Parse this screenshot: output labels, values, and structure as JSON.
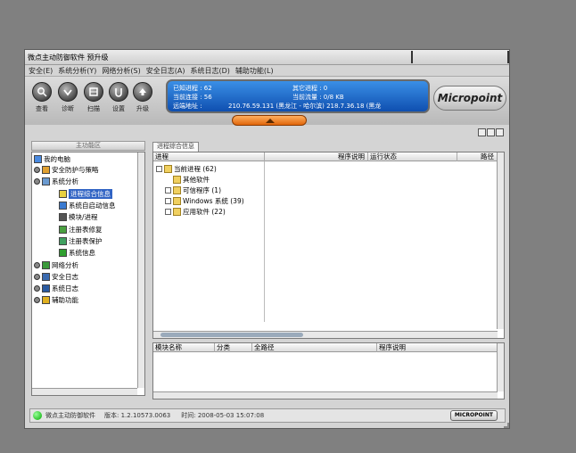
{
  "window": {
    "title": "微点主动防御软件  预升级"
  },
  "menu": [
    "安全(E)",
    "系统分析(Y)",
    "网络分析(S)",
    "安全日志(A)",
    "系统日志(D)",
    "辅助功能(L)"
  ],
  "toolbar": [
    {
      "label": "查看",
      "icon": "view-icon"
    },
    {
      "label": "诊断",
      "icon": "diagnose-icon"
    },
    {
      "label": "扫描",
      "icon": "scan-icon"
    },
    {
      "label": "设置",
      "icon": "settings-icon"
    },
    {
      "label": "升级",
      "icon": "upgrade-icon"
    }
  ],
  "info": {
    "known_label": "已知进程 : 62",
    "other_label": "其它进程 : 0",
    "conn_label": "当前连接 : 56",
    "traffic_label": "当前流量 : 0/8 KB",
    "remote_label": "远端地址 :",
    "remote_value": "210.76.59.131 (黑龙江 - 哈尔滨)    218.7.36.18 (黑龙"
  },
  "logo": "Micropoint",
  "left": {
    "header": "主功能区",
    "items": [
      {
        "label": "我的电脑"
      },
      {
        "label": "安全防护与策略"
      },
      {
        "label": "系统分析"
      },
      {
        "label": "进程综合信息"
      },
      {
        "label": "系统自启动信息"
      },
      {
        "label": "模块/进程"
      },
      {
        "label": "注册表修复"
      },
      {
        "label": "注册表保护"
      },
      {
        "label": "系统信息"
      },
      {
        "label": "网络分析"
      },
      {
        "label": "安全日志"
      },
      {
        "label": "系统日志"
      },
      {
        "label": "辅助功能"
      }
    ]
  },
  "right": {
    "tab": "进程综合信息",
    "upper_cols": [
      "进程",
      "程序说明",
      "运行状态",
      "路径"
    ],
    "tree": [
      {
        "label": "当前进程 (62)"
      },
      {
        "label": "其他软件"
      },
      {
        "label": "可信程序 (1)"
      },
      {
        "label": "Windows 系统 (39)"
      },
      {
        "label": "应用软件 (22)"
      }
    ],
    "lower_cols": [
      "模块名称",
      "分类",
      "全路径",
      "程序说明"
    ]
  },
  "status": {
    "app": "微点主动防御软件",
    "version": "版本: 1.2.10573.0063",
    "time": "时间: 2008-05-03 15:07:08",
    "badge": "MICROPOINT"
  }
}
